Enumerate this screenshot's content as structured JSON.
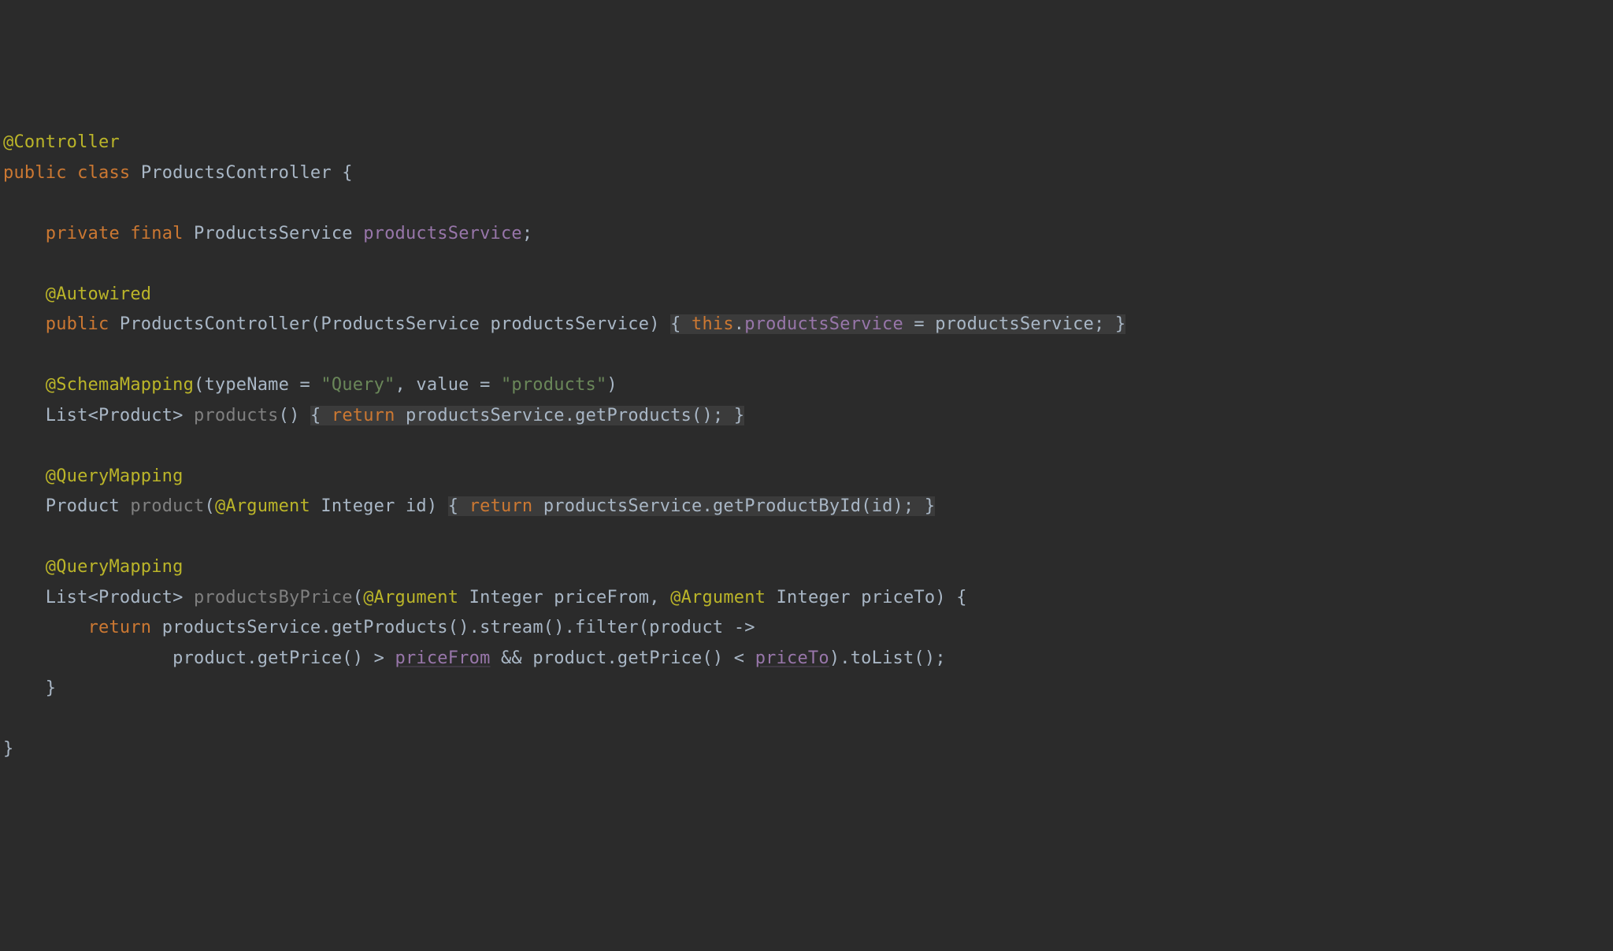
{
  "code": {
    "annotation_controller": "@Controller",
    "kw_public1": "public",
    "kw_class": "class",
    "classname": "ProductsController",
    "open_brace1": "{",
    "kw_private": "private",
    "kw_final": "final",
    "type_ps": "ProductsService",
    "field_ps": "productsService",
    "semi": ";",
    "annotation_autowired": "@Autowired",
    "kw_public2": "public",
    "ctor_name": "ProductsController",
    "param_type_ps": "ProductsService",
    "param_name_ps": "productsService",
    "ctor_body_open": "{",
    "kw_this": "this",
    "dot": ".",
    "assign_field": "productsService",
    "eq": " = ",
    "assign_rhs": "productsService",
    "ctor_body_close": "}",
    "annotation_schemamapping": "@SchemaMapping",
    "sm_lparen": "(",
    "sm_arg1_k": "typeName",
    "sm_arg1_eq": " = ",
    "sm_arg1_v": "\"Query\"",
    "sm_comma": ", ",
    "sm_arg2_k": "value",
    "sm_arg2_eq": " = ",
    "sm_arg2_v": "\"products\"",
    "sm_rparen": ")",
    "ret_list": "List",
    "lt": "<",
    "ret_product": "Product",
    "gt": ">",
    "m_products": "products",
    "body_products_open": "{",
    "kw_return1": "return",
    "call_ps1": "productsService",
    "m_getProducts": "getProducts",
    "body_products_close": "}",
    "annotation_querymapping1": "@QueryMapping",
    "ret_product2": "Product",
    "m_product": "product",
    "anno_argument1": "@Argument",
    "type_integer1": "Integer",
    "param_id": "id",
    "body_product_open": "{",
    "kw_return2": "return",
    "call_ps2": "productsService",
    "m_getProductById": "getProductById",
    "arg_id": "id",
    "body_product_close": "}",
    "annotation_querymapping2": "@QueryMapping",
    "ret_list2": "List",
    "ret_product3": "Product",
    "m_productsByPrice": "productsByPrice",
    "anno_argument2": "@Argument",
    "type_integer2": "Integer",
    "param_priceFrom": "priceFrom",
    "anno_argument3": "@Argument",
    "type_integer3": "Integer",
    "param_priceTo": "priceTo",
    "open_brace2": "{",
    "kw_return3": "return",
    "call_ps3": "productsService",
    "m_getProducts2": "getProducts",
    "m_stream": "stream",
    "m_filter": "filter",
    "lambda_param": "product",
    "lambda_arrow": " ->",
    "lambda_var1": "product",
    "m_getPrice1": "getPrice",
    "op_gt": " > ",
    "ref_priceFrom": "priceFrom",
    "op_and": " && ",
    "lambda_var2": "product",
    "m_getPrice2": "getPrice",
    "op_lt": " < ",
    "ref_priceTo": "priceTo",
    "m_toList": "toList",
    "close_brace_method": "}",
    "close_brace_class": "}"
  }
}
